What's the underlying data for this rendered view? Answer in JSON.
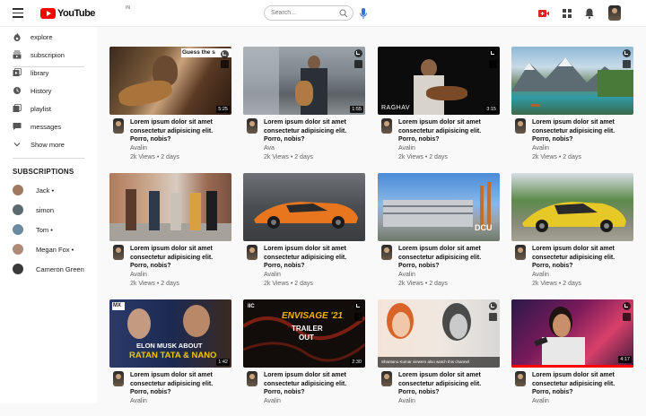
{
  "header": {
    "logo_text": "YouTube",
    "logo_sup": "IN",
    "search_placeholder": "Search..."
  },
  "sidebar": {
    "items": [
      {
        "label": "explore",
        "icon": "fire-icon"
      },
      {
        "label": "subscripion",
        "icon": "subscriptions-icon"
      },
      {
        "label": "library",
        "icon": "library-icon"
      },
      {
        "label": "History",
        "icon": "history-icon"
      },
      {
        "label": "playlist",
        "icon": "playlist-icon"
      },
      {
        "label": "messages",
        "icon": "messages-icon"
      },
      {
        "label": "Show more",
        "icon": "chevron-down-icon"
      }
    ],
    "subscriptions_title": "SUBSCRIPTIONS",
    "subscriptions": [
      {
        "name": "Jack •"
      },
      {
        "name": "simon"
      },
      {
        "name": "Tom •"
      },
      {
        "name": "Megan Fox •"
      },
      {
        "name": "Cameron Green"
      }
    ]
  },
  "videos": [
    {
      "title": "Lorem ipsum dolor sit amet consectetur adipisicing elit. Porro, nobis?",
      "channel": "Avalin",
      "meta": "2k Views • 2 days",
      "duration": "5:25",
      "overlay": "Guess the s"
    },
    {
      "title": "Lorem ipsum dolor sit amet consectetur adipisicing elit. Porro, nobis?",
      "channel": "Ava",
      "meta": "2k Views • 2 days",
      "duration": "1:55",
      "overlay": ""
    },
    {
      "title": "Lorem ipsum dolor sit amet consectetur adipisicing elit. Porro, nobis?",
      "channel": "Avalin",
      "meta": "2k Views • 2 days",
      "duration": "3:15",
      "overlay": "RAGHAV"
    },
    {
      "title": "Lorem ipsum dolor sit amet consectetur adipisicing elit. Porro, nobis?",
      "channel": "Avalin",
      "meta": "2k Views • 2 days",
      "duration": "",
      "overlay": ""
    },
    {
      "title": "Lorem ipsum dolor sit amet consectetur adipisicing elit. Porro, nobis?",
      "channel": "Avalin",
      "meta": "2k Views • 2 days",
      "duration": "",
      "overlay": ""
    },
    {
      "title": "Lorem ipsum dolor sit amet consectetur adipisicing elit. Porro, nobis?",
      "channel": "Avalin",
      "meta": "2k Views • 2 days",
      "duration": "",
      "overlay": ""
    },
    {
      "title": "Lorem ipsum dolor sit amet consectetur adipisicing elit. Porro, nobis?",
      "channel": "Avalin",
      "meta": "2k Views • 2 days",
      "duration": "",
      "overlay": "DCU"
    },
    {
      "title": "Lorem ipsum dolor sit amet consectetur adipisicing elit. Porro, nobis?",
      "channel": "Avalin",
      "meta": "2k Views • 2 days",
      "duration": "",
      "overlay": ""
    },
    {
      "title": "Lorem ipsum dolor sit amet consectetur adipisicing elit. Porro, nobis?",
      "channel": "Avalin",
      "meta": "",
      "duration": "1:42",
      "overlay": "ELON MUSK ABOUT",
      "overlay2": "RATAN TATA & NANO",
      "badge": "MX"
    },
    {
      "title": "Lorem ipsum dolor sit amet consectetur adipisicing elit. Porro, nobis?",
      "channel": "Avalin",
      "meta": "",
      "duration": "2:30",
      "overlay": "ENVISAGE '21",
      "overlay2": "TRAILER",
      "overlay3": "OUT",
      "badge": "IIC"
    },
    {
      "title": "Lorem ipsum dolor sit amet consectetur adipisicing elit. Porro, nobis?",
      "channel": "Avalin",
      "meta": "",
      "duration": "",
      "overlay": "Shantanu Kumar viewers also watch this channel"
    },
    {
      "title": "Lorem ipsum dolor sit amet consectetur adipisicing elit. Porro, nobis?",
      "channel": "Avalin",
      "meta": "",
      "duration": "4:17",
      "overlay": ""
    }
  ]
}
